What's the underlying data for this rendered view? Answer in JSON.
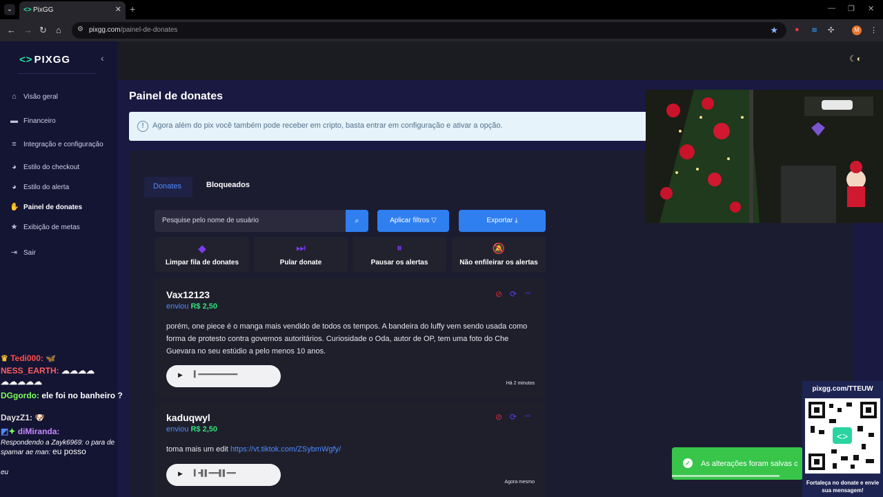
{
  "browser": {
    "tab_title": "PixGG",
    "url_domain": "pixgg.com",
    "url_path": "/painel-de-donates",
    "profile_initial": "M"
  },
  "sidebar": {
    "logo": "PIXGG",
    "items": [
      {
        "label": "Visão geral",
        "icon": "home-icon"
      },
      {
        "label": "Financeiro",
        "icon": "wallet-icon"
      },
      {
        "label": "Integração e configuração",
        "icon": "settings-icon"
      },
      {
        "label": "Estilo do checkout",
        "icon": "palette-icon"
      },
      {
        "label": "Estilo do alerta",
        "icon": "palette-icon"
      },
      {
        "label": "Painel de donates",
        "icon": "hand-coin-icon"
      },
      {
        "label": "Exibição de metas",
        "icon": "star-icon"
      },
      {
        "label": "Sair",
        "icon": "logout-icon"
      }
    ],
    "active_index": 5
  },
  "page": {
    "title": "Painel de donates",
    "notice": "Agora além do pix você também pode receber em cripto, basta entrar em configuração e ativar a opção.",
    "tabs": [
      "Donates",
      "Bloqueados"
    ],
    "search_placeholder": "Pesquise pelo nome de usuário",
    "filter_label": "Aplicar filtros",
    "export_label": "Exportar",
    "actions": [
      {
        "label": "Limpar fila de donates",
        "icon": "eraser-icon"
      },
      {
        "label": "Pular donate",
        "icon": "skip-icon"
      },
      {
        "label": "Pausar os alertas",
        "icon": "pause-icon"
      },
      {
        "label": "Não enfileirar os alertas",
        "icon": "bell-off-icon"
      }
    ]
  },
  "donates": [
    {
      "name": "Vax12123",
      "sent_prefix": "enviou",
      "amount": "R$ 2,50",
      "message": "porém, one piece é o manga mais vendido de todos os tempos. A bandeira do luffy vem sendo usada como forma de protesto contra governos autoritários. Curiosidade o Oda, autor de OP, tem uma foto do Che Guevara no seu estúdio a pelo menos 10 anos.",
      "link": "",
      "time": "Há 2 minutos"
    },
    {
      "name": "kaduqwyl",
      "sent_prefix": "enviou",
      "amount": "R$ 2,50",
      "message": "toma mais um edit",
      "link": "https://vt.tiktok.com/ZSybmWgfy/",
      "time": "Agora mesmo"
    }
  ],
  "toast": {
    "text": "As alterações foram salvas c",
    "progress": 0.82
  },
  "qr": {
    "url": "pixgg.com/TTEUW",
    "caption": "Fortaleça no donate e envie sua mensagem!"
  },
  "chat": [
    {
      "user": "Tedi000:",
      "text": "",
      "color": "#ff4d4d"
    },
    {
      "user": "NESS_EARTH:",
      "text": "",
      "color": "#ff5e5e"
    },
    {
      "user": "DGgordo:",
      "text": "ele foi no banheiro ?",
      "color": "#7dff5a"
    },
    {
      "user": "DayzZ1:",
      "text": "",
      "color": "#e0e0e0"
    },
    {
      "user": "diMiranda:",
      "text": "",
      "color": "#c58cff"
    },
    {
      "reply": "Respondendo a Zayk6969: o para de spamar ae man:",
      "text": "eu posso"
    },
    {
      "tail": "eu"
    }
  ],
  "colors": {
    "accent": "#2f7ff0",
    "brand": "#2fe0a0",
    "sidebar": "#141433",
    "success": "#38c54a"
  }
}
